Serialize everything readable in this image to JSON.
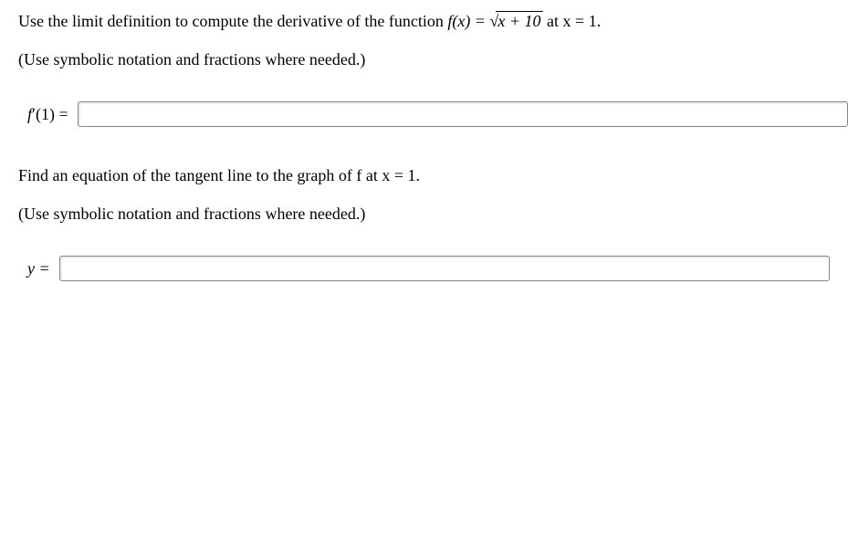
{
  "part1": {
    "text_before": "Use the limit definition to compute the derivative of the function ",
    "func_lhs": "f(x) = ",
    "sqrt_sym": "√",
    "sqrt_arg": "x + 10",
    "text_after": " at x = 1.",
    "instruction": "(Use symbolic notation and fractions where needed.)",
    "label_f": "f",
    "label_prime": "′",
    "label_arg": "(1) = "
  },
  "part2": {
    "prompt": "Find an equation of the tangent line to the graph of  f  at x = 1.",
    "instruction": "(Use symbolic notation and fractions where needed.)",
    "label": "y = "
  }
}
